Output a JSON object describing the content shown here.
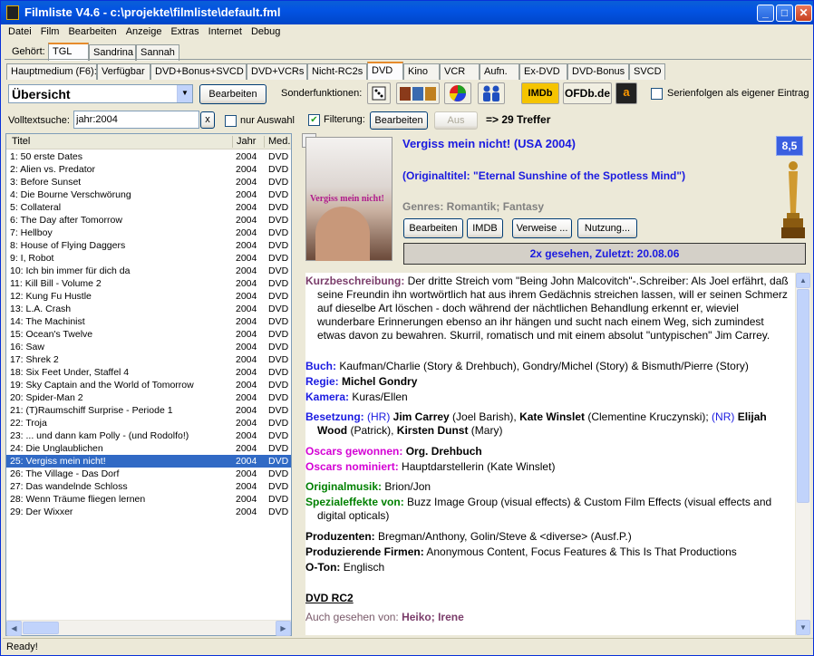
{
  "window": {
    "title": "Filmliste V4.6 - c:\\projekte\\filmliste\\default.fml"
  },
  "menu": [
    "Datei",
    "Film",
    "Bearbeiten",
    "Anzeige",
    "Extras",
    "Internet",
    "Debug"
  ],
  "owner_tabs": {
    "label": "Gehört:",
    "items": [
      "TGL",
      "Sandrina",
      "Sannah"
    ],
    "selected": "TGL"
  },
  "medium_tabs": {
    "items": [
      "Hauptmedium (F6):",
      "Verfügbar",
      "DVD+Bonus+SVCD",
      "DVD+VCRs",
      "Nicht-RC2s",
      "DVD",
      "Kino",
      "VCR",
      "Aufn.",
      "Ex-DVD",
      "DVD-Bonus",
      "SVCD"
    ],
    "selected": "DVD"
  },
  "toolbar": {
    "view_select": "Übersicht",
    "edit_button": "Bearbeiten",
    "special_label": "Sonderfunktionen:",
    "imdb_button": "IMDb",
    "ofdb_button": "OFDb.de",
    "amazon_button": "a",
    "series_label": "Serienfolgen als eigener Eintrag",
    "series_checked": false
  },
  "search": {
    "label": "Volltextsuche:",
    "value": "jahr:2004",
    "clear_button": "x",
    "only_selection_label": "nur Auswahl",
    "only_selection_checked": false,
    "filter_label": "Filterung:",
    "filter_checked": true,
    "filter_edit_button": "Bearbeiten",
    "filter_off_button": "Aus",
    "result_text": "=> 29 Treffer"
  },
  "list": {
    "columns": [
      "Titel",
      "Jahr",
      "Med."
    ],
    "rows": [
      [
        "1: 50 erste Dates",
        "2004",
        "DVD"
      ],
      [
        "2: Alien vs. Predator",
        "2004",
        "DVD"
      ],
      [
        "3: Before Sunset",
        "2004",
        "DVD"
      ],
      [
        "4: Die Bourne Verschwörung",
        "2004",
        "DVD"
      ],
      [
        "5: Collateral",
        "2004",
        "DVD"
      ],
      [
        "6: The Day after Tomorrow",
        "2004",
        "DVD"
      ],
      [
        "7: Hellboy",
        "2004",
        "DVD"
      ],
      [
        "8: House of Flying Daggers",
        "2004",
        "DVD"
      ],
      [
        "9: I, Robot",
        "2004",
        "DVD"
      ],
      [
        "10: Ich bin immer für dich da",
        "2004",
        "DVD"
      ],
      [
        "11: Kill Bill - Volume 2",
        "2004",
        "DVD"
      ],
      [
        "12: Kung Fu Hustle",
        "2004",
        "DVD"
      ],
      [
        "13: L.A. Crash",
        "2004",
        "DVD"
      ],
      [
        "14: The Machinist",
        "2004",
        "DVD"
      ],
      [
        "15: Ocean's Twelve",
        "2004",
        "DVD"
      ],
      [
        "16: Saw",
        "2004",
        "DVD"
      ],
      [
        "17: Shrek 2",
        "2004",
        "DVD"
      ],
      [
        "18: Six Feet Under, Staffel 4",
        "2004",
        "DVD"
      ],
      [
        "19: Sky Captain and the World of Tomorrow",
        "2004",
        "DVD"
      ],
      [
        "20: Spider-Man 2",
        "2004",
        "DVD"
      ],
      [
        "21: (T)Raumschiff Surprise - Periode 1",
        "2004",
        "DVD"
      ],
      [
        "22: Troja",
        "2004",
        "DVD"
      ],
      [
        "23: ... und dann kam Polly - (und Rodolfo!)",
        "2004",
        "DVD"
      ],
      [
        "24: Die Unglaublichen",
        "2004",
        "DVD"
      ],
      [
        "25: Vergiss mein nicht!",
        "2004",
        "DVD"
      ],
      [
        "26: The Village - Das Dorf",
        "2004",
        "DVD"
      ],
      [
        "27: Das wandelnde Schloss",
        "2004",
        "DVD"
      ],
      [
        "28: Wenn Träume fliegen lernen",
        "2004",
        "DVD"
      ],
      [
        "29: Der Wixxer",
        "2004",
        "DVD"
      ]
    ],
    "selected_index": 24
  },
  "detail": {
    "close_button": "x",
    "poster_text": "Vergiss mein nicht!",
    "title": "Vergiss mein nicht! (USA 2004)",
    "original_title": "(Originaltitel: \"Eternal Sunshine of the Spotless Mind\")",
    "genres": "Genres: Romantik; Fantasy",
    "rating": "8,5",
    "buttons": {
      "edit": "Bearbeiten",
      "imdb": "IMDB",
      "refs": "Verweise ...",
      "usage": "Nutzung..."
    },
    "seen": "2x gesehen, Zuletzt: 20.08.06",
    "summary_label": "Kurzbeschreibung:",
    "summary": " Der dritte Streich vom \"Being John Malcovitch\"-.Schreiber: Als Joel erfährt, daß seine Freundin ihn wortwörtlich hat aus ihrem Gedächnis streichen lassen, will er seinen Schmerz auf dieselbe Art löschen - doch während der nächtlichen Behandlung erkennt er, wieviel wunderbare Erinnerungen ebenso an ihr hängen und sucht nach einem Weg, sich zumindest etwas davon zu bewahren. Skurril, romatisch und mit einem absolut \"untypischen\" Jim Carrey.",
    "book_label": "Buch:",
    "book": " Kaufman/Charlie (Story & Drehbuch), Gondry/Michel (Story) & Bismuth/Pierre (Story)",
    "director_label": "Regie:",
    "director": " Michel Gondry",
    "camera_label": "Kamera:",
    "camera": " Kuras/Ellen",
    "cast_label": "Besetzung:",
    "cast_hr": " (HR) ",
    "cast_1": "Jim Carrey",
    "cast_1r": " (Joel Barish), ",
    "cast_2": "Kate Winslet",
    "cast_2r": " (Clementine Kruczynski); ",
    "cast_nr": "(NR) ",
    "cast_3": "Elijah Wood",
    "cast_3r": " (Patrick), ",
    "cast_4": "Kirsten Dunst",
    "cast_4r": " (Mary)",
    "oscars_won_label": "Oscars gewonnen:",
    "oscars_won": " Org. Drehbuch",
    "oscars_nom_label": "Oscars nominiert:",
    "oscars_nom": " Hauptdarstellerin (Kate Winslet)",
    "music_label": "Originalmusik:",
    "music": " Brion/Jon",
    "sfx_label": "Spezialeffekte von:",
    "sfx": " Buzz Image Group (visual effects) & Custom Film Effects (visual effects and digital opticals)",
    "producers_label": "Produzenten:",
    "producers": " Bregman/Anthony, Golin/Steve & <diverse> (Ausf.P.)",
    "companies_label": "Produzierende Firmen:",
    "companies": " Anonymous Content, Focus Features & This Is That Productions",
    "audio_label": "O-Ton:",
    "audio": " Englisch",
    "dvd_heading": "DVD RC2",
    "also_seen_label": "Auch gesehen von:",
    "also_seen": " Heiko; Irene"
  },
  "status": "Ready!"
}
